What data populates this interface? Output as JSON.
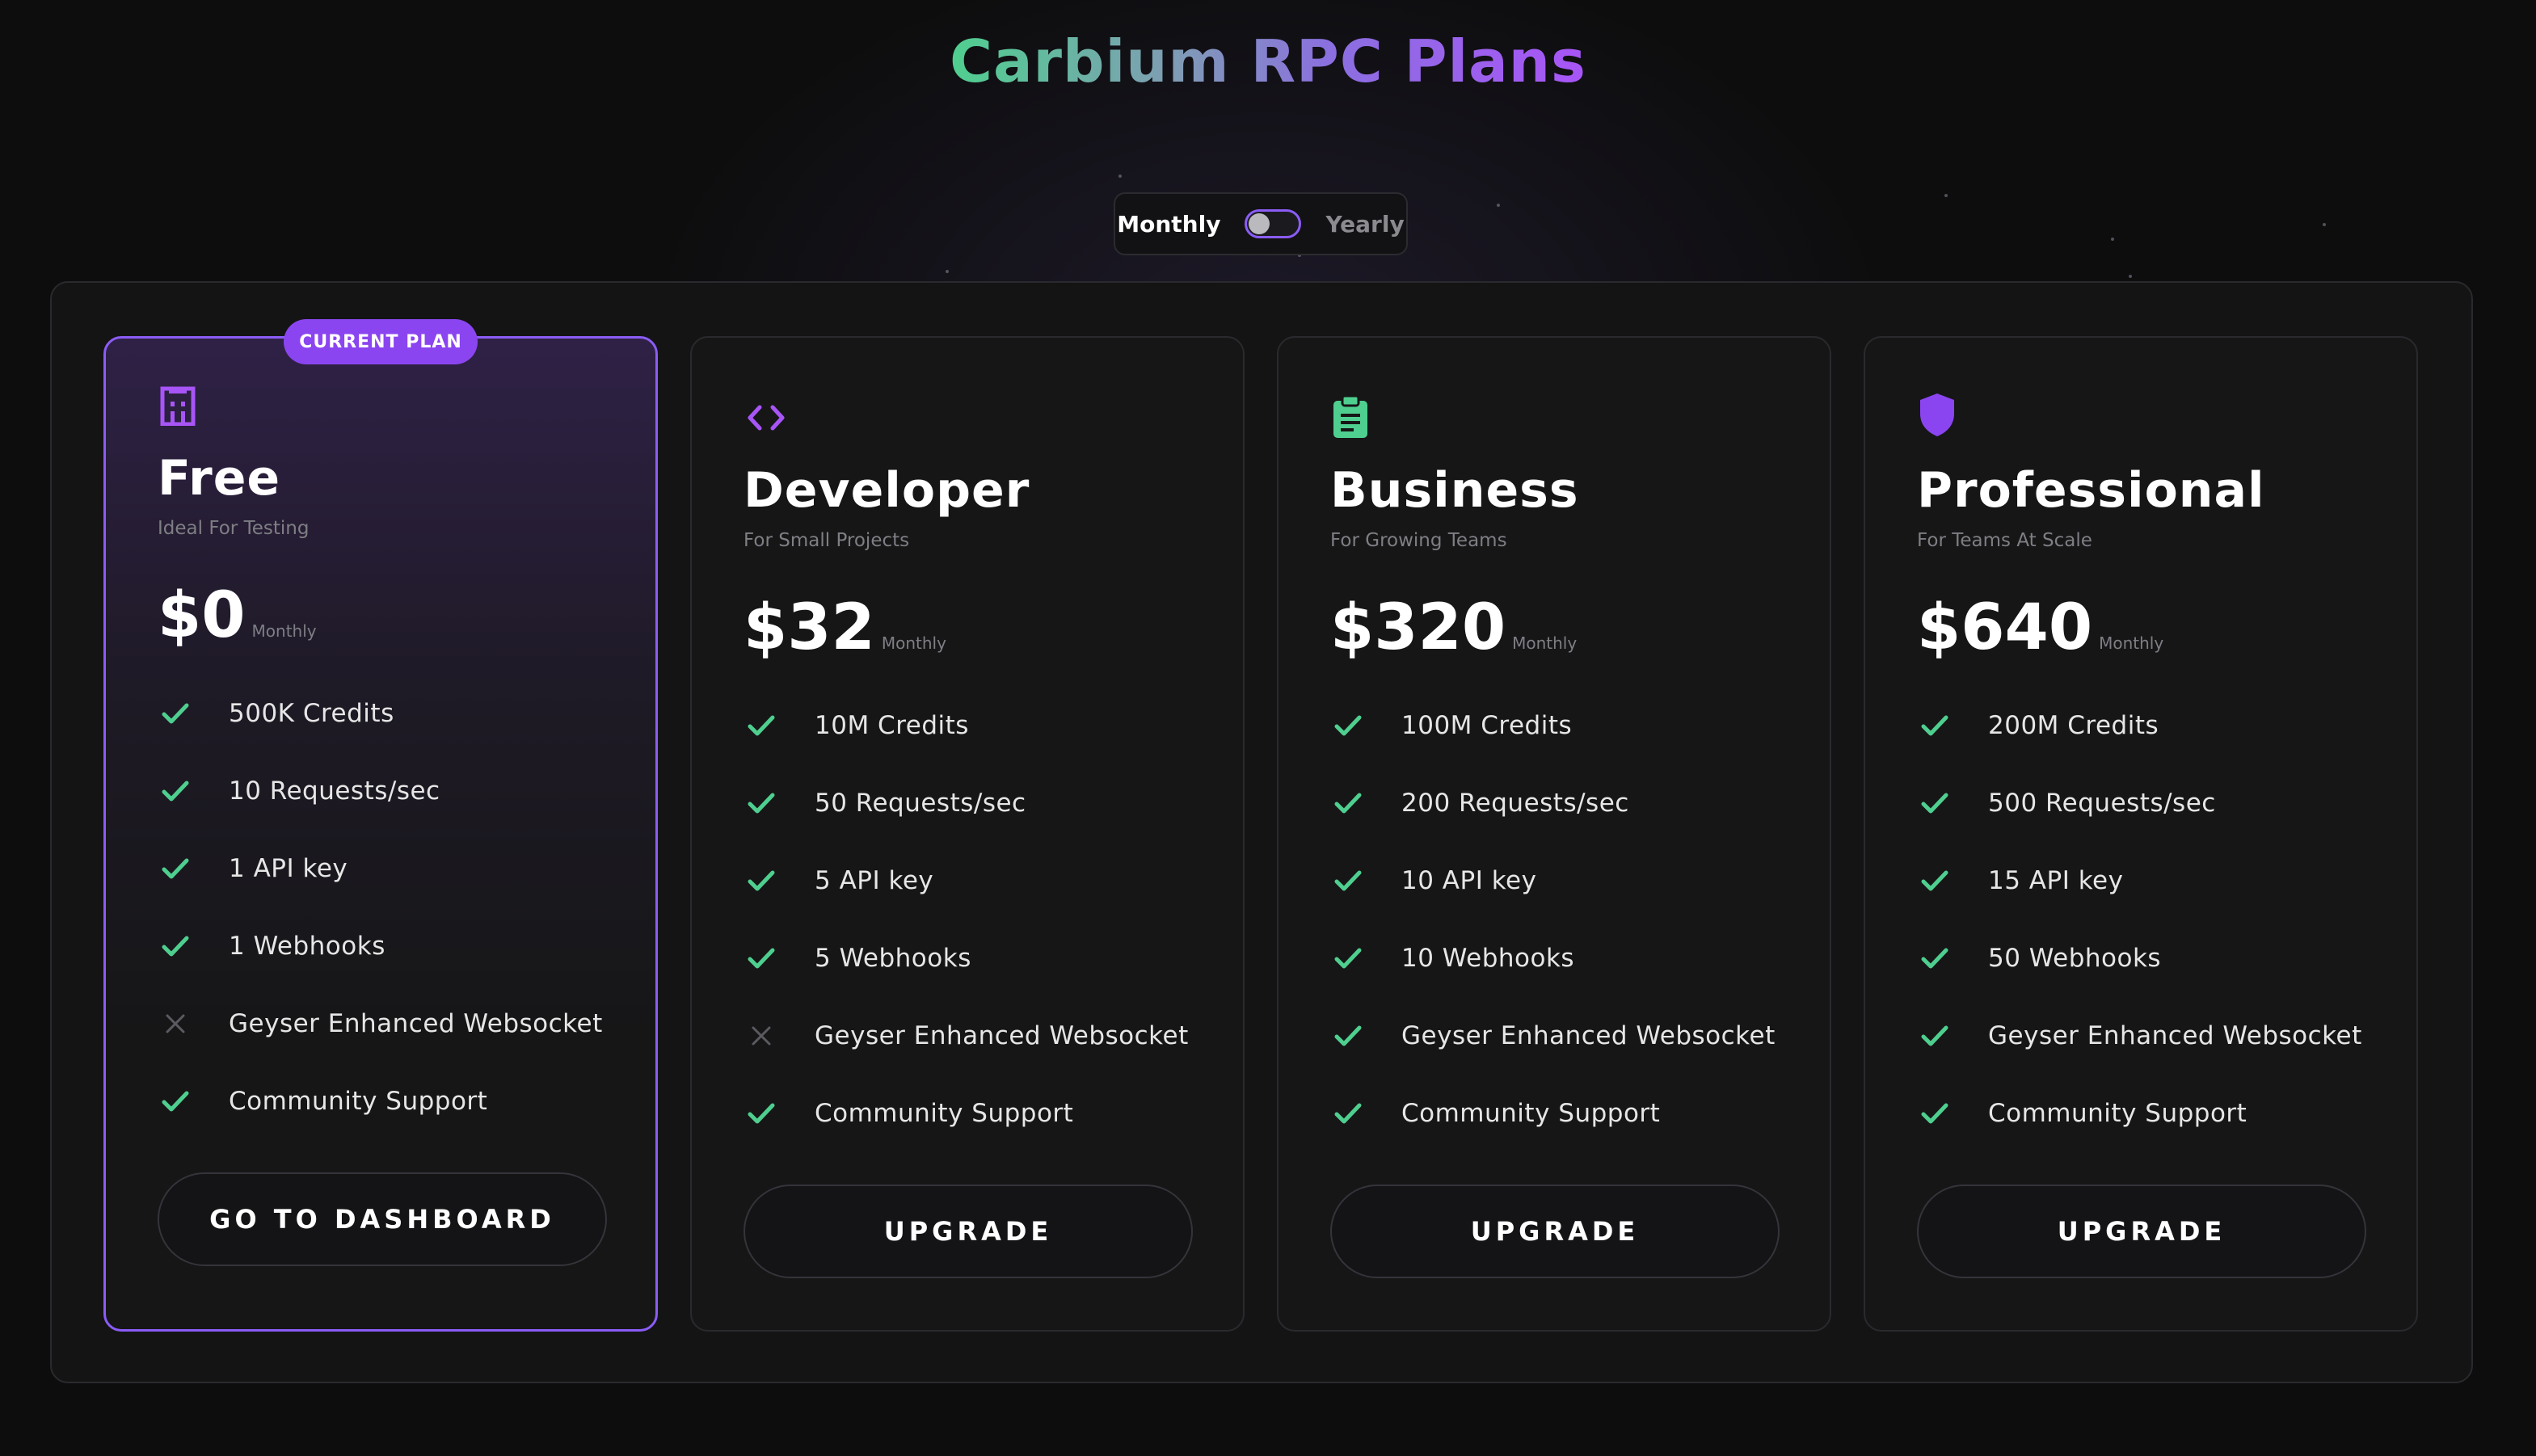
{
  "page": {
    "title": "Carbium RPC Plans"
  },
  "billing_toggle": {
    "monthly_label": "Monthly",
    "yearly_label": "Yearly",
    "selected": "Monthly"
  },
  "colors": {
    "accent": "#8b5cf6",
    "check": "#4fcf8f",
    "cross": "#5a5a60"
  },
  "plans": [
    {
      "name": "Free",
      "subtitle": "Ideal For Testing",
      "price": "$0",
      "period": "Monthly",
      "badge": "CURRENT PLAN",
      "icon": "building-icon",
      "button_label": "GO TO DASHBOARD",
      "features": [
        {
          "text": "500K Credits",
          "included": true
        },
        {
          "text": "10 Requests/sec",
          "included": true
        },
        {
          "text": "1 API key",
          "included": true
        },
        {
          "text": "1 Webhooks",
          "included": true
        },
        {
          "text": "Geyser Enhanced Websocket",
          "included": false
        },
        {
          "text": "Community Support",
          "included": true
        }
      ]
    },
    {
      "name": "Developer",
      "subtitle": "For Small Projects",
      "price": "$32",
      "period": "Monthly",
      "icon": "code-icon",
      "button_label": "UPGRADE",
      "features": [
        {
          "text": "10M Credits",
          "included": true
        },
        {
          "text": "50 Requests/sec",
          "included": true
        },
        {
          "text": "5 API key",
          "included": true
        },
        {
          "text": "5 Webhooks",
          "included": true
        },
        {
          "text": "Geyser Enhanced Websocket",
          "included": false
        },
        {
          "text": "Community Support",
          "included": true
        }
      ]
    },
    {
      "name": "Business",
      "subtitle": "For Growing Teams",
      "price": "$320",
      "period": "Monthly",
      "icon": "clipboard-icon",
      "button_label": "UPGRADE",
      "features": [
        {
          "text": "100M Credits",
          "included": true
        },
        {
          "text": "200 Requests/sec",
          "included": true
        },
        {
          "text": "10 API key",
          "included": true
        },
        {
          "text": "10 Webhooks",
          "included": true
        },
        {
          "text": "Geyser Enhanced Websocket",
          "included": true
        },
        {
          "text": "Community Support",
          "included": true
        }
      ]
    },
    {
      "name": "Professional",
      "subtitle": "For Teams At Scale",
      "price": "$640",
      "period": "Monthly",
      "icon": "shield-icon",
      "button_label": "UPGRADE",
      "features": [
        {
          "text": "200M Credits",
          "included": true
        },
        {
          "text": "500 Requests/sec",
          "included": true
        },
        {
          "text": "15 API key",
          "included": true
        },
        {
          "text": "50 Webhooks",
          "included": true
        },
        {
          "text": "Geyser Enhanced Websocket",
          "included": true
        },
        {
          "text": "Community Support",
          "included": true
        }
      ]
    }
  ]
}
